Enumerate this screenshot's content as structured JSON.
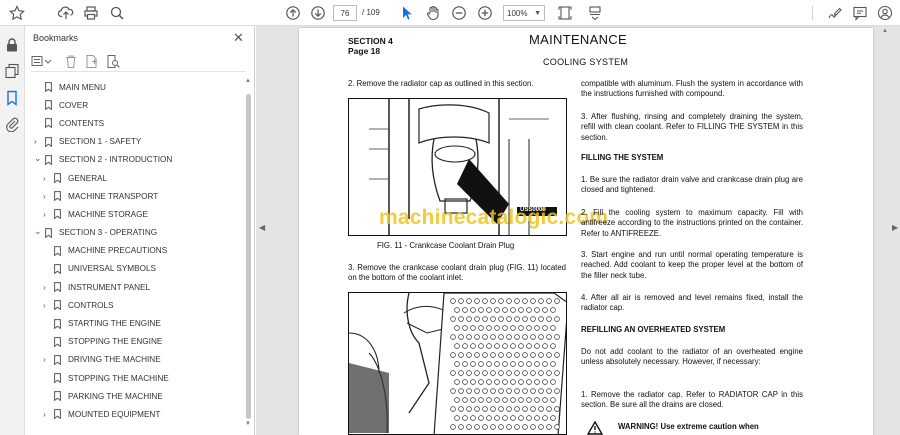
{
  "toolbar": {
    "page_current": "76",
    "page_total": "/ 109",
    "zoom": "100%",
    "icons": [
      "star-icon",
      "upload-icon",
      "print-icon",
      "zoom-search-icon",
      "page-up-icon",
      "page-down-icon",
      "select-cursor-icon",
      "hand-icon",
      "zoom-out-icon",
      "zoom-in-icon",
      "page-fit-icon",
      "scroll-mode-icon",
      "sign-icon",
      "comment-icon",
      "user-icon"
    ]
  },
  "rail": {
    "icons": [
      "lock-icon",
      "pages-icon",
      "bookmark-icon",
      "attachment-icon"
    ]
  },
  "bookmarks": {
    "title": "Bookmarks",
    "close": "✕",
    "items": [
      {
        "label": "MAIN MENU",
        "expandable": false,
        "level": 0
      },
      {
        "label": "COVER",
        "expandable": false,
        "level": 0
      },
      {
        "label": "CONTENTS",
        "expandable": false,
        "level": 0
      },
      {
        "label": "SECTION 1 - SAFETY",
        "expandable": true,
        "expanded": false,
        "level": 0
      },
      {
        "label": "SECTION 2 - INTRODUCTION",
        "expandable": true,
        "expanded": true,
        "level": 0
      },
      {
        "label": "GENERAL",
        "expandable": true,
        "expanded": false,
        "level": 1
      },
      {
        "label": "MACHINE TRANSPORT",
        "expandable": true,
        "expanded": false,
        "level": 1
      },
      {
        "label": "MACHINE STORAGE",
        "expandable": true,
        "expanded": false,
        "level": 1
      },
      {
        "label": "SECTION 3 - OPERATING",
        "expandable": true,
        "expanded": true,
        "level": 0
      },
      {
        "label": "MACHINE PRECAUTIONS",
        "expandable": false,
        "level": 1
      },
      {
        "label": "UNIVERSAL SYMBOLS",
        "expandable": false,
        "level": 1
      },
      {
        "label": "INSTRUMENT PANEL",
        "expandable": true,
        "expanded": false,
        "level": 1
      },
      {
        "label": "CONTROLS",
        "expandable": true,
        "expanded": false,
        "level": 1
      },
      {
        "label": "STARTING THE ENGINE",
        "expandable": false,
        "level": 1
      },
      {
        "label": "STOPPING THE ENGINE",
        "expandable": false,
        "level": 1
      },
      {
        "label": "DRIVING THE MACHINE",
        "expandable": true,
        "expanded": false,
        "level": 1
      },
      {
        "label": "STOPPING THE MACHINE",
        "expandable": false,
        "level": 1
      },
      {
        "label": "PARKING THE MACHINE",
        "expandable": false,
        "level": 1
      },
      {
        "label": "MOUNTED EQUIPMENT",
        "expandable": true,
        "expanded": false,
        "level": 1
      }
    ]
  },
  "document": {
    "section": "SECTION 4",
    "page": "Page 18",
    "heading": "MAINTENANCE",
    "subheading": "COOLING SYSTEM",
    "left": {
      "step2": "2.   Remove the radiator cap as outlined in this section.",
      "fig_label": "USS0000",
      "fig11_caption": "FIG. 11 - Crankcase Coolant Drain Plug",
      "step3": "3. Remove the crankcase coolant drain plug (FIG. 11) located on the bottom of the coolant inlet."
    },
    "right": {
      "para1": "compatible with aluminum. Flush the system in accordance with the instructions furnished with compound.",
      "para2": "3. After flushing, rinsing and completely draining the system, refill with clean coolant. Refer to FILLING THE SYSTEM in this section.",
      "heading_fill": "FILLING THE SYSTEM",
      "fill1": "1. Be sure the radiator drain valve and crankcase drain plug are closed and tightened.",
      "fill2": "2. Fill the cooling system to maximum capacity. Fill with antifreeze according to the instructions printed on the container. Refer to ANTIFREEZE.",
      "fill3": "3. Start engine and run until normal operating temperature is reached. Add coolant to keep the proper level at the bottom of the filler neck tube.",
      "fill4": "4. After all air is removed and level remains fixed, install the radiator cap.",
      "heading_refill": "REFILLING AN OVERHEATED SYSTEM",
      "refill_intro": "Do not add coolant to the radiator of an overheated engine unless absolutely necessary. However, if necessary:",
      "refill1": "1. Remove the radiator cap. Refer to RADIATOR CAP in this section. Be sure all the drains are closed.",
      "warning": "WARNING!  Use  extreme  caution  when"
    },
    "watermark": "machinecatalogic.com"
  }
}
